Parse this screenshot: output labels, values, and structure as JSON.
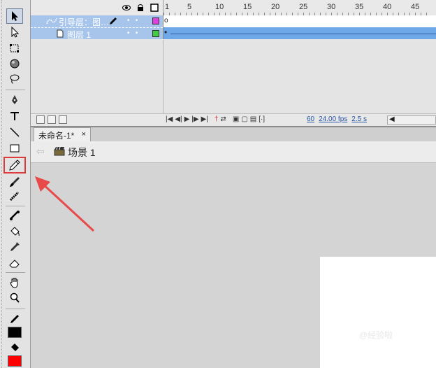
{
  "timeline": {
    "ruler_numbers": [
      "1",
      "5",
      "10",
      "15",
      "20",
      "25",
      "30",
      "35",
      "40",
      "45"
    ],
    "layers": [
      {
        "name": "引导层：图…",
        "icon": "guide-layer-icon",
        "color": "#e040e0",
        "frame_marker": "o"
      },
      {
        "name": "图层 1",
        "icon": "layer-icon",
        "color": "#44cc44",
        "frame_marker": "•"
      }
    ],
    "readouts": {
      "frame": "60",
      "fps": "24.00 fps",
      "time": "2.5 s"
    }
  },
  "document": {
    "tab_label": "未命名-1*",
    "close_label": "×",
    "scene_label": "场景 1"
  },
  "toolbar": {
    "stroke_color": "#000000",
    "fill_color": "#ff0000",
    "highlighted_tool": "pencil-tool"
  },
  "watermark": "@经验啦"
}
